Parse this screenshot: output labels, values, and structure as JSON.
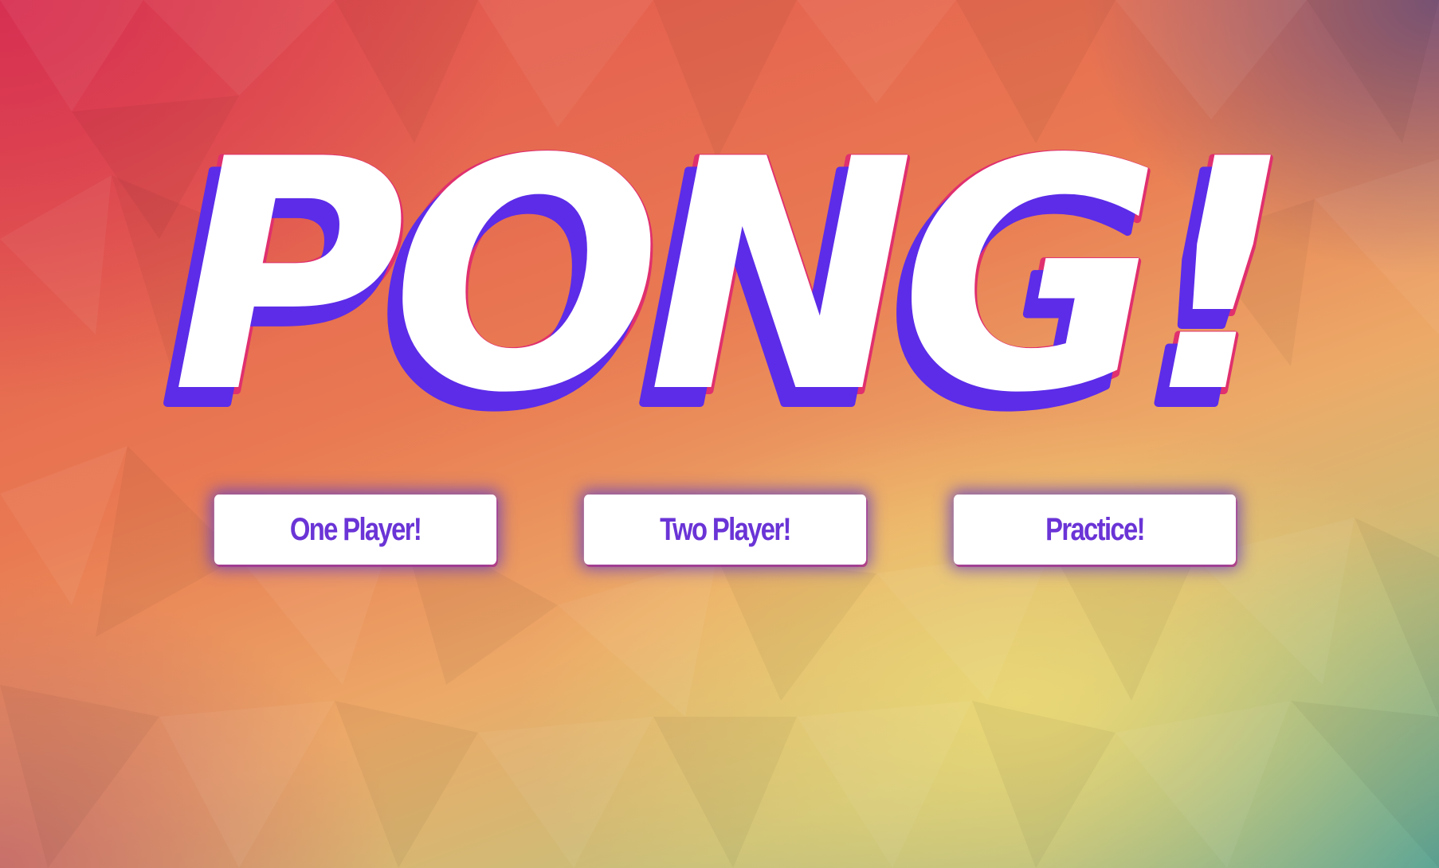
{
  "game": {
    "title": "PONG!"
  },
  "menu": {
    "buttons": [
      {
        "label": "One Player!"
      },
      {
        "label": "Two Player!"
      },
      {
        "label": "Practice!"
      }
    ]
  },
  "colors": {
    "title_fill": "#ffffff",
    "title_shadow_purple": "#5c2ce8",
    "title_shadow_pink": "#e0306e",
    "button_text": "#6a34d6",
    "button_glow": "#603cc8"
  }
}
